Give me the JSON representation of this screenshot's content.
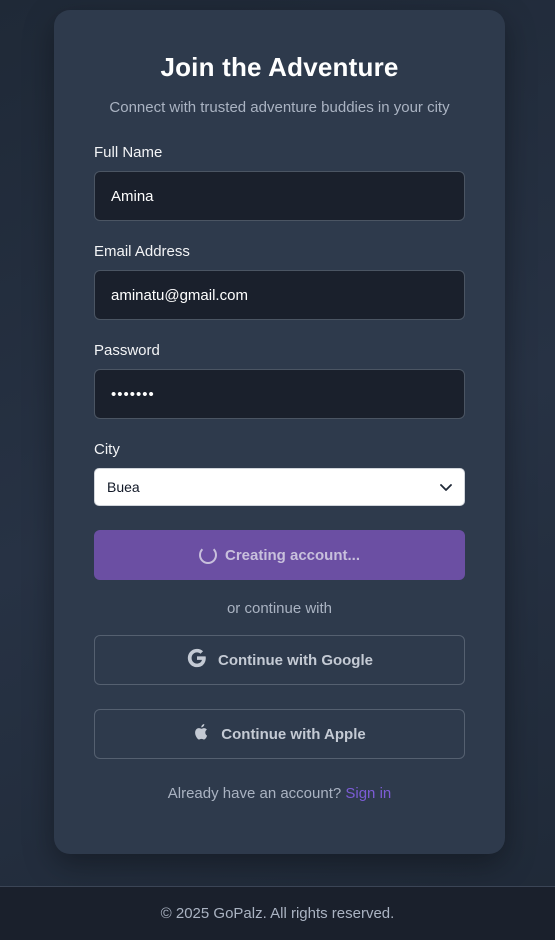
{
  "form": {
    "title": "Join the Adventure",
    "subtitle": "Connect with trusted adventure buddies in your city",
    "full_name_label": "Full Name",
    "full_name_value": "Amina",
    "email_label": "Email Address",
    "email_value": "aminatu@gmail.com",
    "password_label": "Password",
    "password_value": "•••••••",
    "city_label": "City",
    "city_selected": "Buea",
    "submit_label": "Creating account...",
    "divider_text": "or continue with",
    "google_label": "Continue with Google",
    "apple_label": "Continue with Apple",
    "signin_prompt": "Already have an account?",
    "signin_link": "Sign in"
  },
  "footer": {
    "text": "© 2025 GoPalz. All rights reserved."
  },
  "icons": {
    "spinner": "loading-spinner-icon",
    "google": "google-icon",
    "apple": "apple-icon",
    "chevron": "chevron-down-icon"
  },
  "colors": {
    "accent": "#6b4fa3",
    "link": "#7c5cd6",
    "card": "#2e3a4c",
    "input_bg": "#1a202c"
  }
}
